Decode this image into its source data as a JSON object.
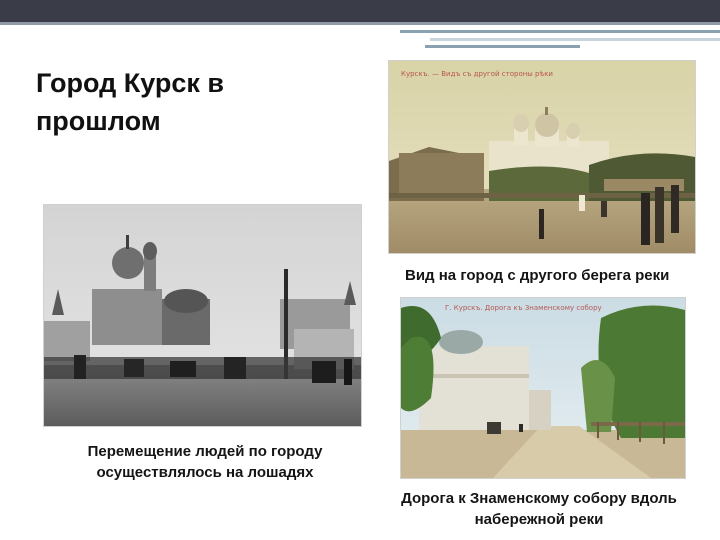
{
  "slide": {
    "title": "Город Курск в прошлом",
    "colors": {
      "header_bar": "#3a3d47",
      "accent": "#8aa1b1"
    }
  },
  "photos": [
    {
      "id": "river-view",
      "caption": "Вид на город с другого берега реки",
      "stamp": "Курскъ. — Видъ съ другой стороны рѣки",
      "tone": "sepia"
    },
    {
      "id": "horses",
      "caption": "Перемещение людей по городу осуществлялось на лошадях",
      "tone": "black-and-white"
    },
    {
      "id": "embankment-road",
      "caption": "Дорога к Знаменскому собору вдоль набережной реки",
      "stamp": "Г. Курскъ. Дорога къ Знаменскому собору",
      "tone": "hand-colored"
    }
  ]
}
